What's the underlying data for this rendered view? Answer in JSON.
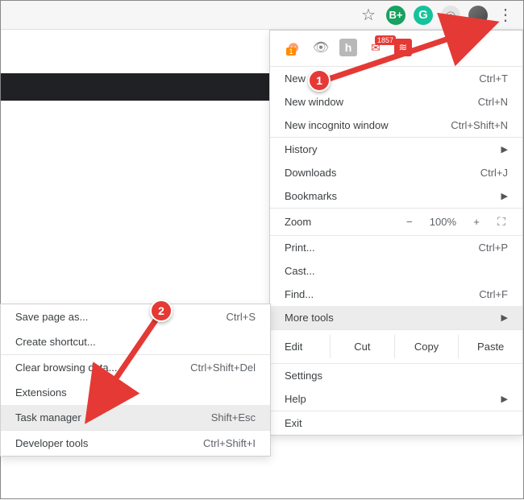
{
  "toolbar_icons": {
    "star": "star-icon",
    "bplus": "B+",
    "grammarly": "G",
    "robot": "☺",
    "avatar": "",
    "menu_dots": "⋮"
  },
  "ext_row": {
    "ghost_badge": "1",
    "gmail_badge": "1857"
  },
  "menu": {
    "new_tab": {
      "label": "New tab",
      "shortcut": "Ctrl+T"
    },
    "new_window": {
      "label": "New window",
      "shortcut": "Ctrl+N"
    },
    "incognito": {
      "label": "New incognito window",
      "shortcut": "Ctrl+Shift+N"
    },
    "history": {
      "label": "History"
    },
    "downloads": {
      "label": "Downloads",
      "shortcut": "Ctrl+J"
    },
    "bookmarks": {
      "label": "Bookmarks"
    },
    "zoom_label": "Zoom",
    "zoom_minus": "−",
    "zoom_value": "100%",
    "zoom_plus": "+",
    "print": {
      "label": "Print...",
      "shortcut": "Ctrl+P"
    },
    "cast": {
      "label": "Cast..."
    },
    "find": {
      "label": "Find...",
      "shortcut": "Ctrl+F"
    },
    "more_tools": {
      "label": "More tools"
    },
    "edit_label": "Edit",
    "edit_cut": "Cut",
    "edit_copy": "Copy",
    "edit_paste": "Paste",
    "settings": {
      "label": "Settings"
    },
    "help": {
      "label": "Help"
    },
    "exit": {
      "label": "Exit"
    }
  },
  "submenu": {
    "save_page": {
      "label": "Save page as...",
      "shortcut": "Ctrl+S"
    },
    "shortcut": {
      "label": "Create shortcut..."
    },
    "clear": {
      "label": "Clear browsing data...",
      "shortcut": "Ctrl+Shift+Del"
    },
    "extensions": {
      "label": "Extensions"
    },
    "task_mgr": {
      "label": "Task manager",
      "shortcut": "Shift+Esc"
    },
    "dev_tools": {
      "label": "Developer tools",
      "shortcut": "Ctrl+Shift+I"
    }
  },
  "annotations": {
    "step1": "1",
    "step2": "2"
  }
}
